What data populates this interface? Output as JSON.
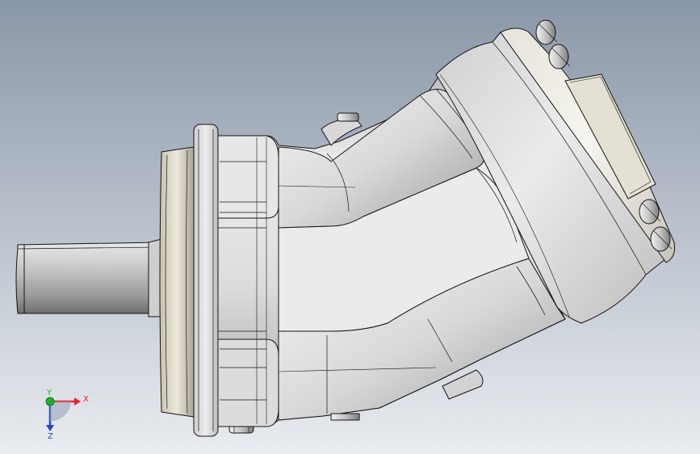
{
  "viewport": {
    "background_top": "#8a97a8",
    "background_bottom": "#e9ecf0"
  },
  "model": {
    "icon": "hydraulic-pump-3d-model",
    "body_color": "#d8d8d8",
    "edge_color": "#141414",
    "flange_face_color": "#f0f0f0"
  },
  "triad": {
    "x_label": "X",
    "y_label": "Y",
    "z_label": "Z",
    "x_color": "#e8262a",
    "y_color": "#1fb427",
    "z_color": "#2448c8"
  }
}
